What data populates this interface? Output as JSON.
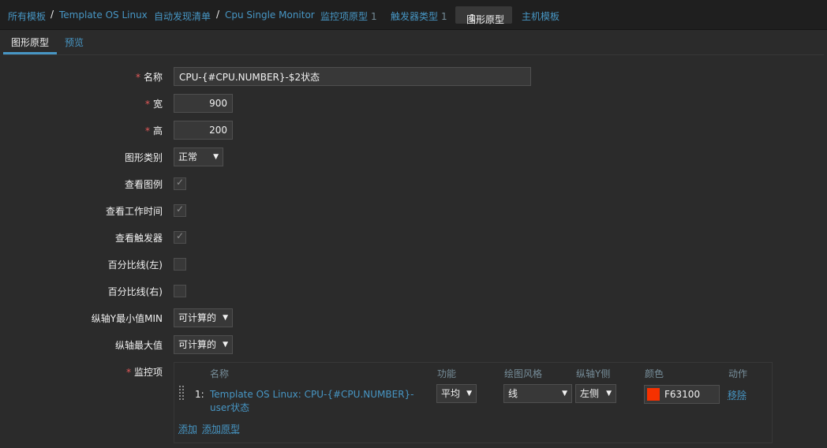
{
  "breadcrumb": {
    "all_templates": "所有模板",
    "template": "Template OS Linux",
    "discovery": "自动发现清单",
    "discovery_rule": "Cpu Single Monitor",
    "item_prototypes": "监控项原型",
    "item_prototypes_count": "1",
    "trigger_types": "触发器类型",
    "trigger_types_count": "1",
    "graph_prototypes": "图形原型",
    "graph_prototypes_count": "1",
    "host_templates": "主机模板"
  },
  "tabs": {
    "graph_prototype": "图形原型",
    "preview": "预览"
  },
  "form": {
    "name_label": "名称",
    "name_value": "CPU-{#CPU.NUMBER}-$2状态",
    "width_label": "宽",
    "width_value": "900",
    "height_label": "高",
    "height_value": "200",
    "graph_type_label": "图形类别",
    "graph_type_value": "正常",
    "show_legend_label": "查看图例",
    "show_working_time_label": "查看工作时间",
    "show_triggers_label": "查看触发器",
    "percentile_left_label": "百分比线(左)",
    "percentile_right_label": "百分比线(右)",
    "y_min_label": "纵轴Y最小值MIN",
    "y_min_value": "可计算的",
    "y_max_label": "纵轴最大值",
    "y_max_value": "可计算的",
    "items_label": "监控项"
  },
  "checkboxes": {
    "show_legend": true,
    "show_working_time": true,
    "show_triggers": true,
    "percentile_left": false,
    "percentile_right": false
  },
  "items_table": {
    "headers": {
      "name": "名称",
      "function": "功能",
      "draw_style": "绘图风格",
      "y_axis_side": "纵轴Y侧",
      "color": "颜色",
      "action": "动作"
    },
    "rows": [
      {
        "index": "1:",
        "name": "Template OS Linux: CPU-{#CPU.NUMBER}-user状态",
        "function": "平均",
        "draw_style": "线",
        "y_axis_side": "左侧",
        "color": "F63100",
        "color_hex": "#F63100",
        "remove": "移除"
      }
    ],
    "add": "添加",
    "add_prototype": "添加原型"
  },
  "colors": {
    "link": "#4796c4",
    "required": "#e45959",
    "background": "#2b2b2b",
    "topbar": "#1f1f1f"
  }
}
